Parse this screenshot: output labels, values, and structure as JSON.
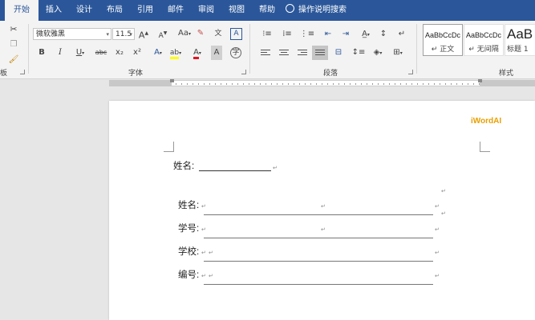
{
  "tabs": [
    "开始",
    "插入",
    "设计",
    "布局",
    "引用",
    "邮件",
    "审阅",
    "视图",
    "帮助"
  ],
  "tell_me": "操作说明搜索",
  "ribbon": {
    "font_name": "微软雅黑",
    "font_size": "11.5",
    "grow_label": "A",
    "shrink_label": "A",
    "change_case": "Aa",
    "phonetic_label": "文",
    "char_border_label": "A",
    "bold": "B",
    "italic": "I",
    "underline": "U",
    "strike": "abc",
    "subscript": "x₂",
    "superscript": "x²",
    "text_effects": "A",
    "highlight": "ab",
    "font_color": "A",
    "char_shading": "A",
    "enclose": "字",
    "group_clipboard": "板",
    "group_font": "字体",
    "group_paragraph": "段落",
    "group_styles": "样式",
    "styles": [
      {
        "preview": "AaBbCcDc",
        "name": "正文"
      },
      {
        "preview": "AaBbCcDc",
        "name": "无间隔"
      },
      {
        "preview": "AaB",
        "name": "标题 1"
      }
    ]
  },
  "document": {
    "brand": "iWordAI",
    "top_label": "姓名:",
    "fields": [
      "姓名:",
      "学号:",
      "学校:",
      "编号:"
    ]
  },
  "colors": {
    "accent": "#2b579a",
    "highlight": "#ffff00",
    "font_color": "#e81123",
    "brand": "#e8a000"
  }
}
